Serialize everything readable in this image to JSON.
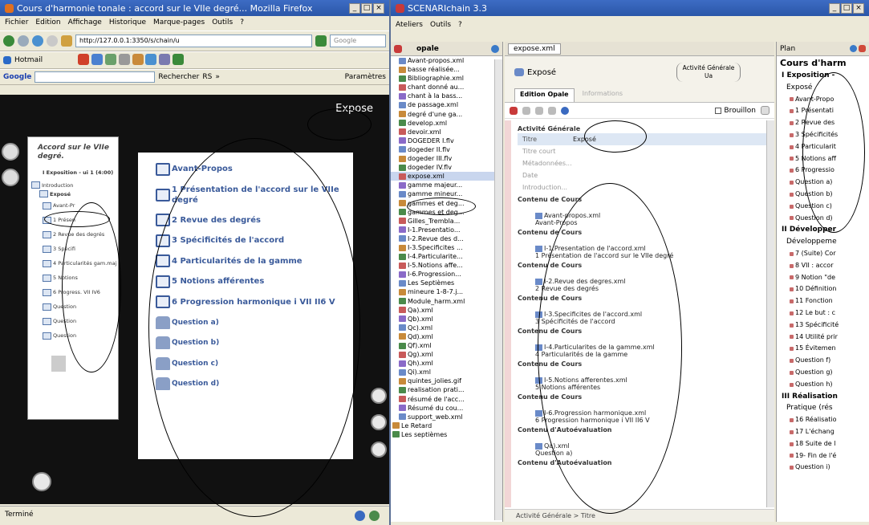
{
  "firefox": {
    "title": "Cours d'harmonie tonale : accord sur le VIIe degré... Mozilla Firefox",
    "menu": [
      "Fichier",
      "Edition",
      "Affichage",
      "Historique",
      "Marque-pages",
      "Outils",
      "?"
    ],
    "url": "http://127.0.0.1:3350/s/chain/u",
    "search_placeholder": "Google",
    "bookmarks": {
      "hotmail": "Hotmail"
    },
    "google_bar": {
      "logo": "Google",
      "search_btn": "Rechercher",
      "rss": "RS",
      "more": "»",
      "params": "Paramètres"
    },
    "page": {
      "header": "Expose",
      "sidebar_title": "Accord sur le VIIe degré.",
      "sidebar_items": [
        "I Exposition - ui 1 (4:00)",
        "Introduction",
        "Exposé",
        "Avant-Pr",
        "1 Présen",
        "2 Revue des degrés",
        "3 Spécifi",
        "4 Particularités gam.maj",
        "5 Notions",
        "6 Progress. VII IV6",
        "Question",
        "Question",
        "Question"
      ],
      "main_items": [
        "Avant-Propos",
        "1 Présentation de l'accord sur le VIIe degré",
        "2 Revue des degrés",
        "3 Spécificités de l'accord",
        "4 Particularités de la gamme",
        "5 Notions afférentes",
        "6 Progression harmonique i VII II6 V",
        "Question a)",
        "Question b)",
        "Question c)",
        "Question d)"
      ]
    },
    "status": "Terminé"
  },
  "scenari": {
    "title": "SCENARIchain 3.3",
    "menu": [
      "Ateliers",
      "Outils",
      "?"
    ],
    "workshop": "opale",
    "tree": [
      "Avant-propos.xml",
      "basse réalisée...",
      "Bibliographie.xml",
      "chant donné au...",
      "chant à la bass...",
      "de passage.xml",
      "degré d'une ga...",
      "develop.xml",
      "devoir.xml",
      "DOGEDER I.flv",
      "dogeder II.flv",
      "dogeder III.flv",
      "dogeder IV.flv",
      "expose.xml",
      "gamme majeur...",
      "gamme mineur...",
      "gammes et deg...",
      "gammes et deg...",
      "Gilles_Trembla...",
      "I-1.Presentatio...",
      "I-2.Revue des d...",
      "I-3.Specificites ...",
      "I-4.Particularite...",
      "I-5.Notions affe...",
      "I-6.Progression...",
      "Les Septièmes",
      "mineure 1-8-7.j...",
      "Module_harm.xml",
      "Qa).xml",
      "Qb).xml",
      "Qc).xml",
      "Qd).xml",
      "Qf).xml",
      "Qg).xml",
      "Qh).xml",
      "Qi).xml",
      "quintes_jolies.gif",
      "realisation prati...",
      "résumé de l'acc...",
      "Résumé du cou...",
      "support_web.xml",
      "Le Retard",
      "Les septièmes"
    ],
    "editor": {
      "tab": "expose.xml",
      "doc_title": "Exposé",
      "doc_type": "Activité Générale Ua",
      "tabs": [
        "Edition Opale",
        "Informations"
      ],
      "brouillon": "Brouillon",
      "section": "Activité Générale",
      "fields": [
        "Titre",
        "Titre court",
        "Métadonnées...",
        "Date",
        "Introduction..."
      ],
      "titre_value": "Exposé",
      "contents": [
        {
          "head": "Contenu de Cours",
          "file": "Avant-propos.xml",
          "title": "Avant-Propos"
        },
        {
          "head": "Contenu de Cours",
          "file": "I-1.Presentation de l'accord.xml",
          "title": "1 Présentation de l'accord sur le VIIe degré"
        },
        {
          "head": "Contenu de Cours",
          "file": "I-2.Revue des degres.xml",
          "title": "2 Revue des degrés"
        },
        {
          "head": "Contenu de Cours",
          "file": "I-3.Specificites de l'accord.xml",
          "title": "3 Spécificités de l'accord"
        },
        {
          "head": "Contenu de Cours",
          "file": "I-4.Particularites de la gamme.xml",
          "title": "4 Particularités de la gamme"
        },
        {
          "head": "Contenu de Cours",
          "file": "I-5.Notions afferentes.xml",
          "title": "5 Notions afférentes"
        },
        {
          "head": "Contenu de Cours",
          "file": "I-6.Progression harmonique.xml",
          "title": "6 Progression harmonique i VII II6 V"
        },
        {
          "head": "Contenu d'Autoévaluation",
          "file": "Qa).xml",
          "title": "Question a)"
        },
        {
          "head": "Contenu d'Autoévaluation",
          "file": "",
          "title": ""
        }
      ],
      "footer": [
        "Activité Générale",
        "Titre"
      ]
    },
    "plan": {
      "label": "Plan",
      "root": "Cours d'harm",
      "items": [
        {
          "t": "I Exposition -",
          "lvl": 1
        },
        {
          "t": "Exposé",
          "lvl": 2
        },
        {
          "t": "Avant-Propo",
          "lvl": 3
        },
        {
          "t": "1 Présentati",
          "lvl": 3
        },
        {
          "t": "2 Revue des",
          "lvl": 3
        },
        {
          "t": "3 Spécificités",
          "lvl": 3
        },
        {
          "t": "4 Particularit",
          "lvl": 3
        },
        {
          "t": "5 Notions aff",
          "lvl": 3
        },
        {
          "t": "6 Progressio",
          "lvl": 3
        },
        {
          "t": "Question a)",
          "lvl": 3
        },
        {
          "t": "Question b)",
          "lvl": 3
        },
        {
          "t": "Question c)",
          "lvl": 3
        },
        {
          "t": "Question d)",
          "lvl": 3
        },
        {
          "t": "II Développer",
          "lvl": 1
        },
        {
          "t": "Développeme",
          "lvl": 2
        },
        {
          "t": "7 (Suite) Cor",
          "lvl": 3
        },
        {
          "t": "8 VII : accor",
          "lvl": 3
        },
        {
          "t": "9 Notion \"de",
          "lvl": 3
        },
        {
          "t": "10 Définition",
          "lvl": 3
        },
        {
          "t": "11 Fonction",
          "lvl": 3
        },
        {
          "t": "12 Le but : c",
          "lvl": 3
        },
        {
          "t": "13 Spécificité",
          "lvl": 3
        },
        {
          "t": "14 Utilité prir",
          "lvl": 3
        },
        {
          "t": "15 Évitemen",
          "lvl": 3
        },
        {
          "t": "Question f)",
          "lvl": 3
        },
        {
          "t": "Question g)",
          "lvl": 3
        },
        {
          "t": "Question h)",
          "lvl": 3
        },
        {
          "t": "III Réalisation",
          "lvl": 1
        },
        {
          "t": "Pratique (rés",
          "lvl": 2
        },
        {
          "t": "16 Réalisatio",
          "lvl": 3
        },
        {
          "t": "17 L'échang",
          "lvl": 3
        },
        {
          "t": "18 Suite de l",
          "lvl": 3
        },
        {
          "t": "19- Fin de l'é",
          "lvl": 3
        },
        {
          "t": "Question i)",
          "lvl": 3
        }
      ]
    }
  },
  "colors": {
    "titlebar": "#2a56a8",
    "link": "#3a5a9a",
    "plan_dot": "#c86a6a",
    "editor_margin": "#f2d6d6"
  }
}
